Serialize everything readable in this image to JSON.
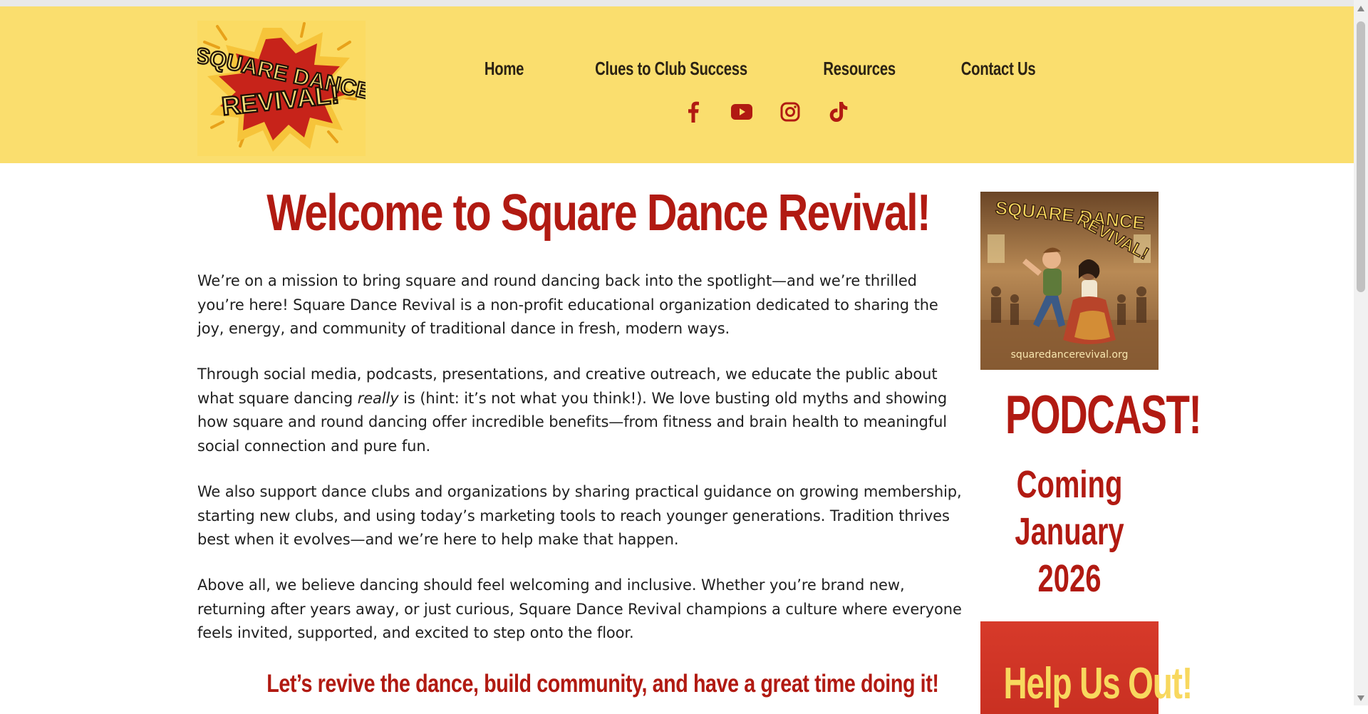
{
  "logo": {
    "line1": "SQUARE DANCE",
    "line2": "REVIVAL!"
  },
  "nav": [
    "Home",
    "Clues to Club Success",
    "Resources",
    "Contact Us"
  ],
  "social": [
    "facebook-icon",
    "youtube-icon",
    "instagram-icon",
    "tiktok-icon"
  ],
  "colors": {
    "header_bg": "#fade6e",
    "accent": "#b11a12",
    "help_bg": "#d73a2a",
    "help_text": "#f8d85e"
  },
  "main": {
    "title": "Welcome to Square Dance Revival!",
    "p1": "We’re on a mission to bring square and round dancing back into the spotlight—and we’re thrilled you’re here! Square Dance Revival is a non-profit educational organization dedicated to sharing the joy, energy, and community of traditional dance in fresh, modern ways.",
    "p2_before": "Through social media, podcasts, presentations, and creative outreach, we educate the public about what square dancing ",
    "p2_em": "really",
    "p2_after": " is (hint: it’s not what you think!). We love busting old myths and showing how square and round dancing offer incredible benefits—from fitness and brain health to meaningful social connection and pure fun.",
    "p3": "We also support dance clubs and organizations by sharing practical guidance on growing membership, starting new clubs, and using today’s marketing tools to reach younger generations. Tradition thrives best when it evolves—and we’re here to help make that happen.",
    "p4": "Above all, we believe dancing should feel welcoming and inclusive. Whether you’re brand new, returning after years away, or just curious, Square Dance Revival champions a culture where everyone feels invited, supported, and excited to step onto the floor.",
    "tagline": "Let’s revive the dance, build community, and have a great time doing it!"
  },
  "sidebar": {
    "promo": {
      "line1": "SQUARE DANCE",
      "line2": "REVIVAL!",
      "url": "squaredancerevival.org"
    },
    "podcast": "PODCAST!",
    "coming": [
      "Coming",
      "January",
      "2026"
    ],
    "help": "Help Us Out!"
  }
}
